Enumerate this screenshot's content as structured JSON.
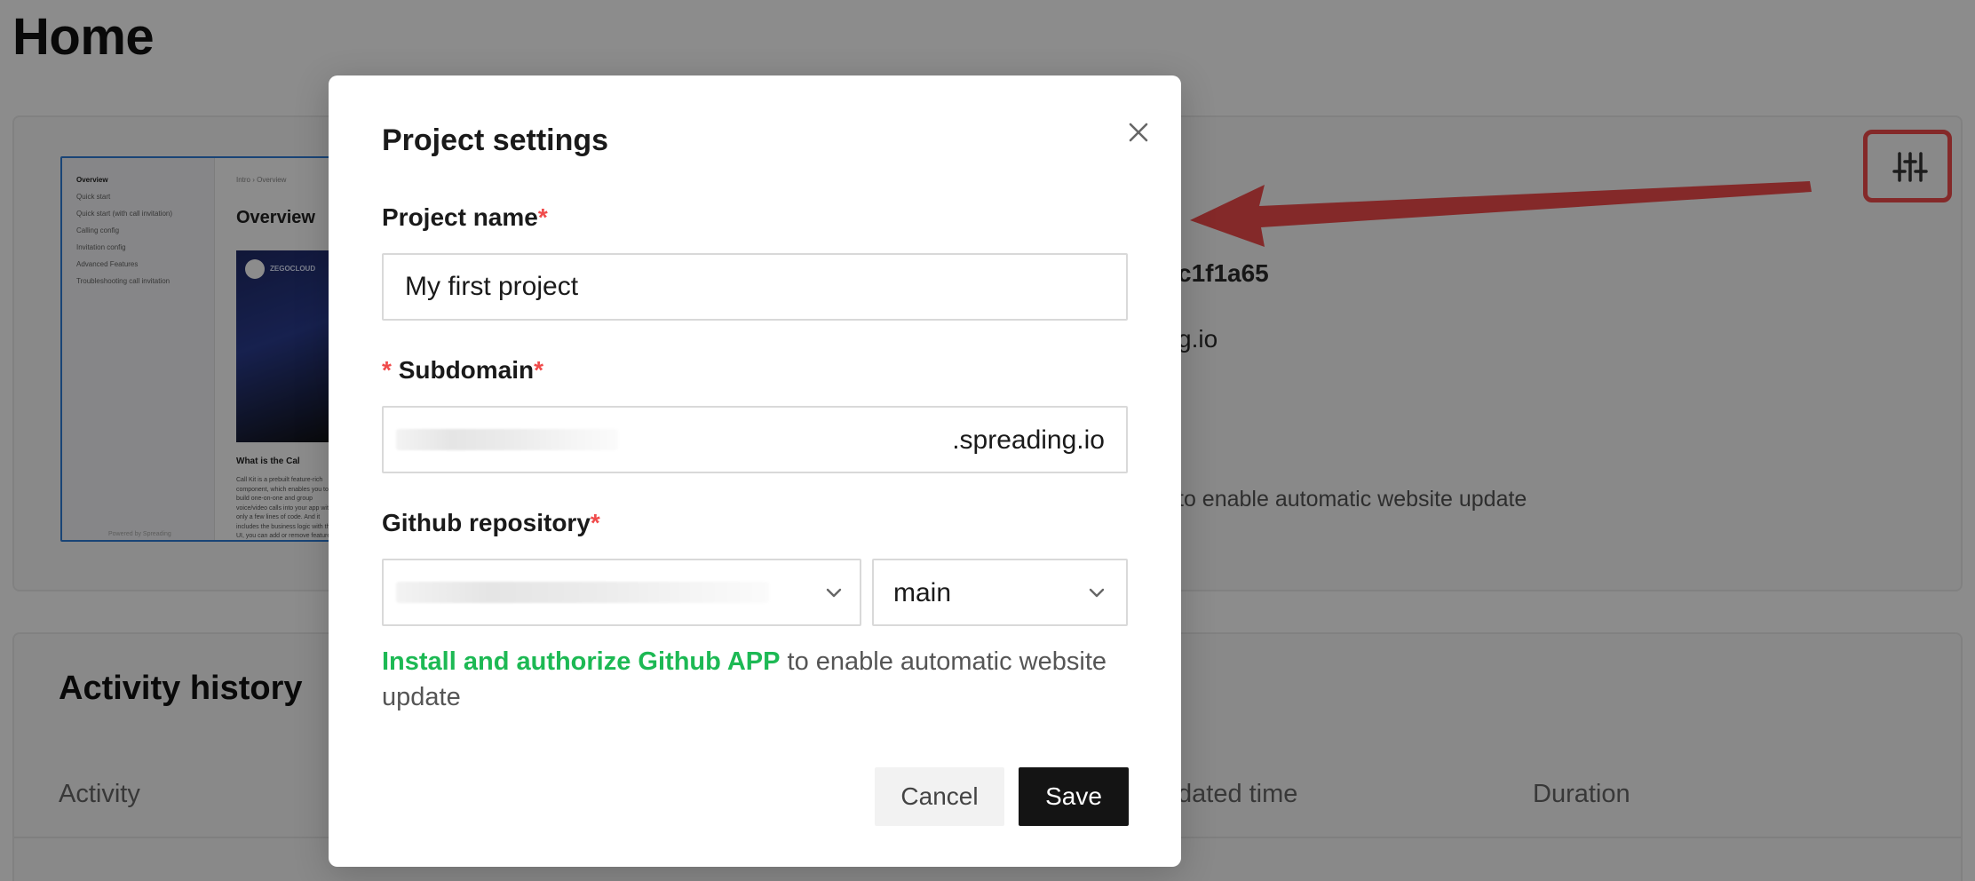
{
  "page": {
    "title": "Home"
  },
  "preview": {
    "sidebar_items": [
      "Overview",
      "Quick start",
      "Quick start (with call invitation)",
      "Calling config",
      "Invitation config",
      "Advanced Features",
      "Troubleshooting call invitation"
    ],
    "breadcrumb": "Intro › Overview",
    "heading": "Overview",
    "video_brand": "ZEGOCLOUD",
    "subheading": "What is the Cal",
    "paragraph": "Call Kit is a prebuilt feature-rich component, which enables you to build one-on-one and group voice/video calls into your app with only a few lines of code. And it includes the business logic with the UI, you can add or remove features",
    "footer": "Powered by Spreading"
  },
  "project_card": {
    "commit_fragment": "c1f1a65",
    "domain_fragment": "g.io",
    "update_hint_fragment": "to enable automatic website update"
  },
  "activity": {
    "title": "Activity history",
    "columns": [
      "Activity",
      "dated time",
      "Duration"
    ]
  },
  "modal": {
    "title": "Project settings",
    "project_name_label": "Project name",
    "project_name_value": "My first project",
    "required_mark": "*",
    "subdomain_label": "Subdomain",
    "subdomain_suffix": ".spreading.io",
    "github_label": "Github repository",
    "branch_value": "main",
    "helper_link": "Install and authorize Github APP",
    "helper_text": " to enable automatic website update",
    "cancel_label": "Cancel",
    "save_label": "Save"
  },
  "colors": {
    "accent_green": "#1db954",
    "required_red": "#f04b4b",
    "annotation_red": "#f04b4b",
    "save_button_bg": "#141414"
  },
  "icons": {
    "close": "close-icon",
    "chevron": "chevron-down-icon",
    "tune": "sliders-icon"
  }
}
